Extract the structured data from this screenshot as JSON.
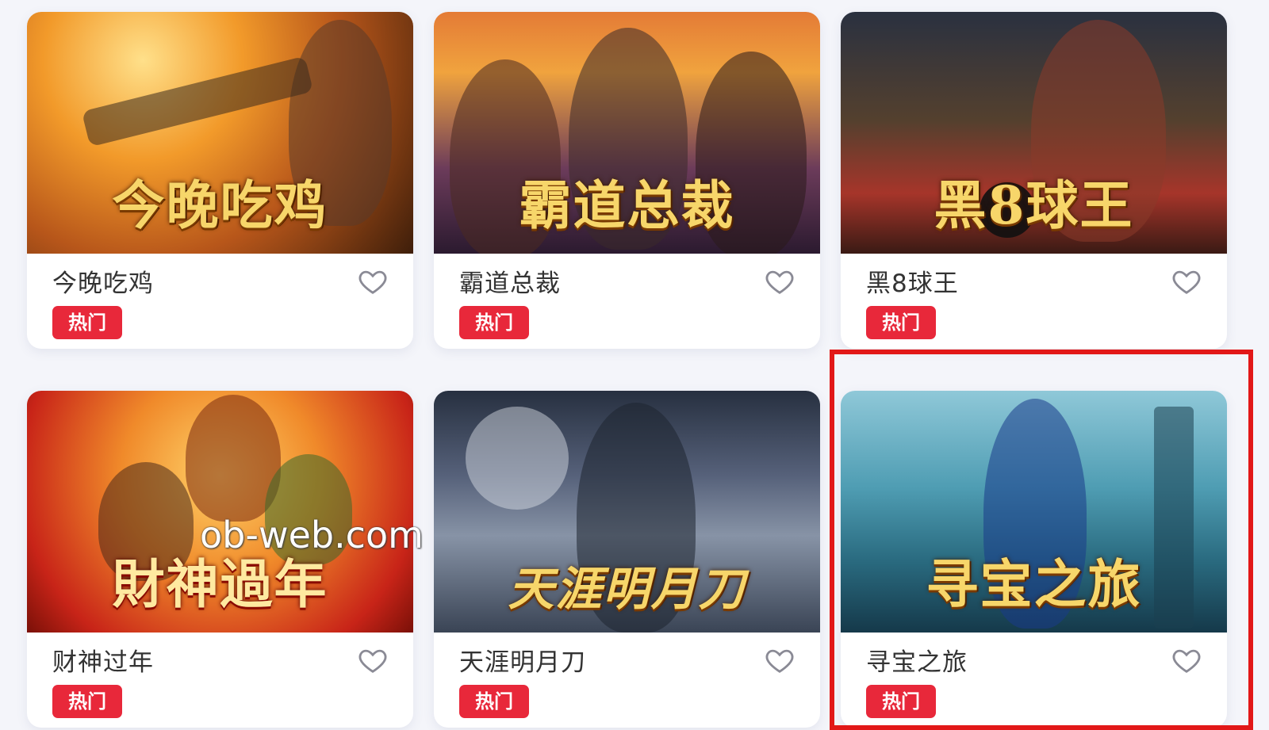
{
  "games": [
    {
      "name": "今晚吃鸡",
      "art_title": "今晚吃鸡",
      "badge": "热门"
    },
    {
      "name": "霸道总裁",
      "art_title": "霸道总裁",
      "badge": "热门"
    },
    {
      "name": "黑8球王",
      "art_title": "黑8球王",
      "badge": "热门"
    },
    {
      "name": "财神过年",
      "art_title": "財神過年",
      "badge": "热门"
    },
    {
      "name": "天涯明月刀",
      "art_title": "天涯明月刀",
      "badge": "热门"
    },
    {
      "name": "寻宝之旅",
      "art_title": "寻宝之旅",
      "badge": "热门"
    }
  ],
  "icons": {
    "favorite": "heart-outline-icon"
  },
  "watermark": "ob-web.com",
  "colors": {
    "badge": "#e8283a",
    "highlight_border": "#e21818",
    "page_background": "#f4f5fa",
    "heart": "#8a8a95"
  }
}
